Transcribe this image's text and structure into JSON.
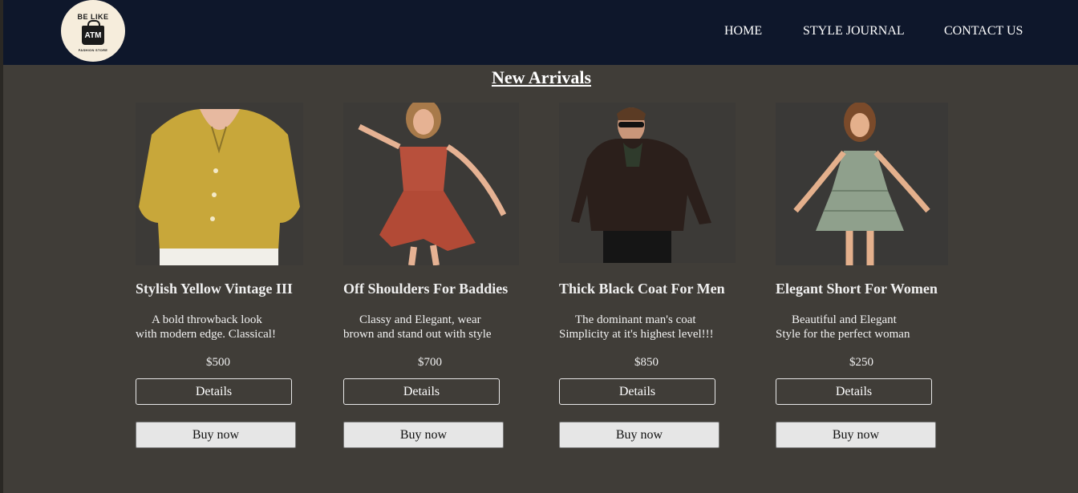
{
  "brand": {
    "logo_top": "BE LIKE",
    "logo_mid": "ATM",
    "logo_bottom": "FASHION STORE"
  },
  "nav": {
    "home": "HOME",
    "style_journal": "STYLE JOURNAL",
    "contact": "CONTACT US"
  },
  "section_title": "New Arrivals",
  "products": [
    {
      "name": "Stylish Yellow Vintage III",
      "desc_line1": "A bold throwback look",
      "desc_line2": "with modern edge. Classical!",
      "price": "$500",
      "details_label": "Details",
      "buy_label": "Buy now",
      "image": "yellow-blouse-photo"
    },
    {
      "name": "Off Shoulders For Baddies",
      "desc_line1": "Classy and Elegant, wear",
      "desc_line2": "brown and stand out with style",
      "price": "$700",
      "details_label": "Details",
      "buy_label": "Buy now",
      "image": "rust-dress-photo"
    },
    {
      "name": "Thick Black Coat For Men",
      "desc_line1": "The dominant man's coat",
      "desc_line2": "Simplicity at it's highest level!!!",
      "price": "$850",
      "details_label": "Details",
      "buy_label": "Buy now",
      "image": "black-leather-jacket-photo"
    },
    {
      "name": "Elegant Short For Women",
      "desc_line1": "Beautiful and Elegant",
      "desc_line2": "Style for the perfect woman",
      "price": "$250",
      "details_label": "Details",
      "buy_label": "Buy now",
      "image": "green-sundress-photo"
    }
  ],
  "colors": {
    "navbar": "#0e172b",
    "page_bg": "#403d38",
    "logo_bg": "#f6eddc",
    "buy_button_bg": "#e6e6e6"
  }
}
